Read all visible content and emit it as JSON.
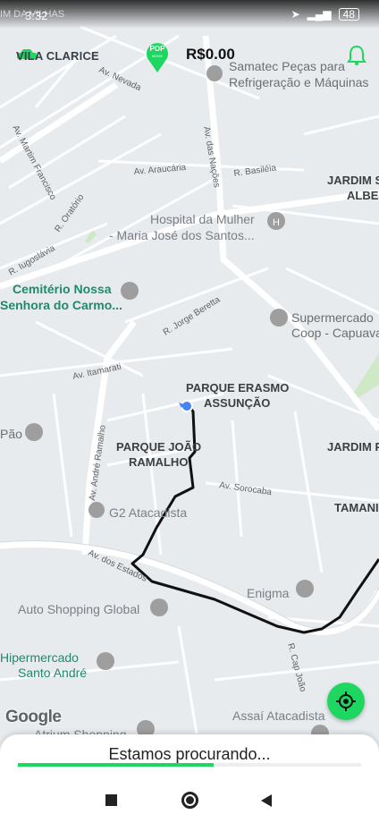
{
  "status_bar": {
    "time": "3:32",
    "ghost_text": "IM DA\nVILHAS",
    "battery": "48"
  },
  "top_bar": {
    "area_name": "VILA CLARICE",
    "logo_text": "POP",
    "logo_sub": "MOVE",
    "balance": "R$0.00"
  },
  "map": {
    "streets": {
      "av_nevada": "Av. Nevada",
      "av_das_nacoes": "Av. das Nações",
      "av_martim_francisco": "Av. Martim Francisco",
      "r_oratorio": "R. Oratório",
      "av_araucaria": "Av. Araucária",
      "r_basileia": "R. Basiléia",
      "r_iugoslavia": "R. Iugoslávia",
      "r_jorge_beretta": "R. Jorge Beretta",
      "av_itamarati": "Av. Itamarati",
      "av_andre_ramalho": "Av. André Ramalho",
      "av_sorocaba": "Av. Sorocaba",
      "av_dos_estados": "Av. dos Estados",
      "r_cap_joao": "R. Cap João"
    },
    "places": {
      "samatec": [
        "Samatec Peças para",
        "Refrigeração e Máquinas"
      ],
      "jardim_top_right": [
        "JARDIM S",
        "ALBER"
      ],
      "hospital": [
        "Hospital da Mulher",
        "- Maria José dos Santos..."
      ],
      "cemiterio": [
        "Cemitério Nossa",
        "Senhora do Carmo..."
      ],
      "supermercado_coop": [
        "Supermercado",
        "Coop - Capuava"
      ],
      "parque_erasmo": [
        "PARQUE ERASMO",
        "ASSUNÇÃO"
      ],
      "pao": "Pão",
      "jardim_right": "JARDIM P",
      "parque_joao": [
        "PARQUE JOÃO",
        "RAMALHO"
      ],
      "tamanduatehy": "TAMANI",
      "g2": "G2 Atacadista",
      "enigma": "Enigma",
      "auto_shopping": "Auto Shopping Global",
      "hipermercado": [
        "Hipermercado",
        "Santo André"
      ],
      "assai": "Assaí Atacadista",
      "atrium": "Atrium Shopping"
    }
  },
  "google_logo": "Google",
  "bottom_sheet": {
    "searching_text": "Estamos procurando...",
    "progress_percent": 57
  },
  "colors": {
    "accent": "#1ed760",
    "map_bg": "#e9ecef",
    "route": "#111111",
    "poi": "#9e9e9e"
  }
}
